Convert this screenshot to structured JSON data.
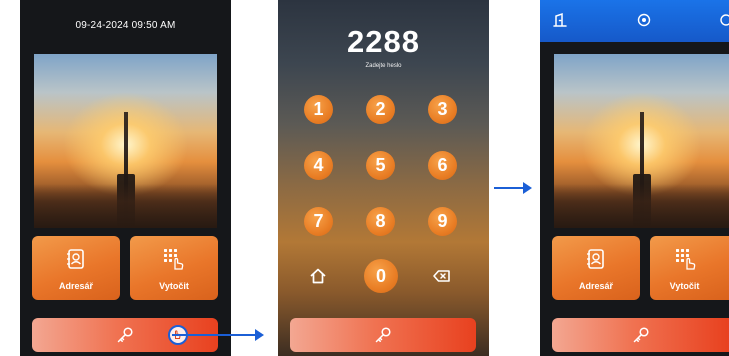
{
  "screen_home": {
    "datetime": "09-24-2024 09:50 AM",
    "tiles": [
      {
        "label": "Adresář",
        "icon": "address-book-icon"
      },
      {
        "label": "Vytočit",
        "icon": "dialpad-tap-icon"
      }
    ],
    "unlock_icon": "key-icon",
    "tap_indicator": "hand-tap-icon"
  },
  "screen_keypad": {
    "code": "2288",
    "hint": "Zadejte heslo",
    "keys": [
      "1",
      "2",
      "3",
      "4",
      "5",
      "6",
      "7",
      "8",
      "9",
      "0"
    ],
    "home_icon": "home-icon",
    "backspace_icon": "backspace-icon",
    "unlock_icon": "key-icon"
  },
  "screen_unlocked": {
    "topbar_icons": [
      "door-open-icon",
      "settings-icon",
      "more-icon"
    ],
    "tiles": [
      {
        "label": "Adresář",
        "icon": "address-book-icon"
      },
      {
        "label": "Vytočit",
        "icon": "dialpad-tap-icon"
      }
    ],
    "unlock_icon": "key-icon"
  },
  "colors": {
    "accent_orange": "#e9762a",
    "unlock_bar_red": "#e8411f",
    "flow_arrow_blue": "#1b5fd6",
    "topbar_blue": "#1a73e8"
  }
}
